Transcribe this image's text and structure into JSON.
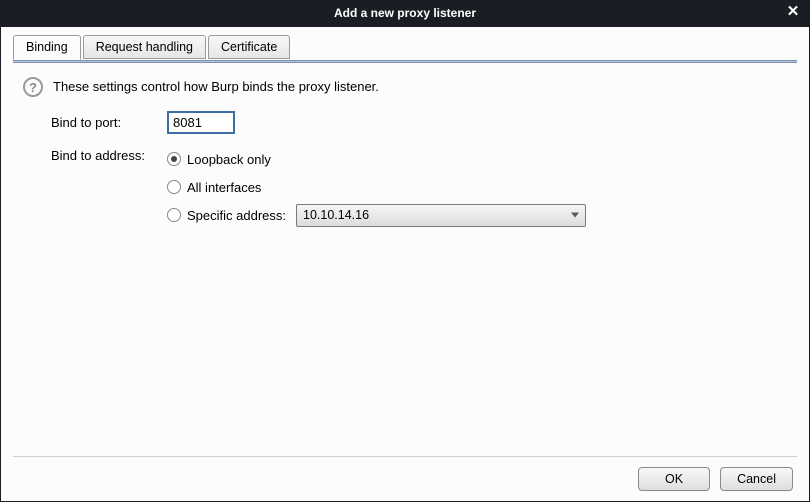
{
  "title": "Add a new proxy listener",
  "tabs": {
    "binding": "Binding",
    "request_handling": "Request handling",
    "certificate": "Certificate"
  },
  "description": "These settings control how Burp binds the proxy listener.",
  "labels": {
    "bind_port": "Bind to port:",
    "bind_address": "Bind to address:"
  },
  "port_value": "8081",
  "radios": {
    "loopback": "Loopback only",
    "all": "All interfaces",
    "specific": "Specific address:"
  },
  "specific_address_selected": "10.10.14.16",
  "buttons": {
    "ok": "OK",
    "cancel": "Cancel"
  }
}
